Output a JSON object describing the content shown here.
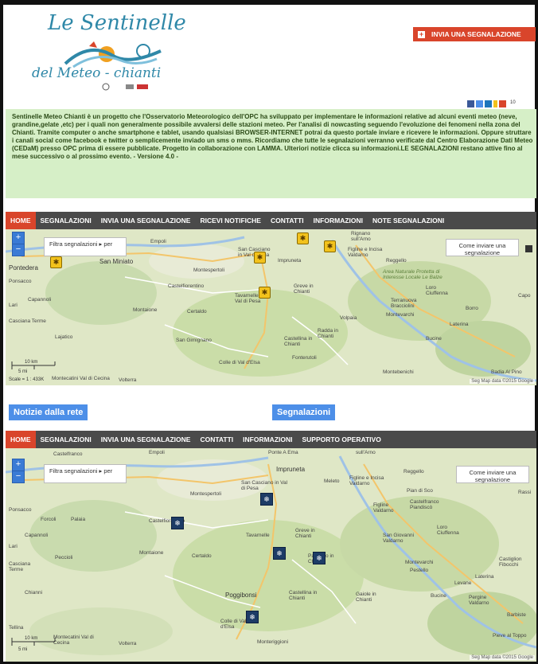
{
  "logo": {
    "line1": "Le Sentinelle",
    "line2": "del Meteo - chianti"
  },
  "report_button": {
    "label": "INVIA UNA SEGNALAZIONE"
  },
  "social": {
    "count": "10"
  },
  "intro_text": "Sentinelle Meteo Chianti è un progetto che l'Osservatorio Meteorologico dell'OPC ha sviluppato per implementare le informazioni relative ad alcuni eventi meteo (neve, grandine,gelate ,etc) per i quali non generalmente possibile avvalersi delle stazioni meteo. Per l'analisi di nowcasting seguendo l'evoluzione dei fenomeni nella zona del Chianti. Tramite computer o anche smartphone e tablet, usando qualsiasi BROWSER-INTERNET potrai da questo portale inviare e ricevere le informazioni. Oppure struttare i canali social come facebook e twitter o semplicemente inviado un sms o mms. Ricordiamo che tutte le segnalazioni verranno verificate dal Centro Elaborazione Dati Meteo (CEDaM) presso OPC prima di essere pubblicate. Progetto in collaborazione con LAMMA. Ulteriori notizie clicca su informazioni.LE SEGNALAZIONI restano attive fino al mese successivo o al prossimo evento. - Versione 4.0 -",
  "nav1": [
    "HOME",
    "SEGNALAZIONI",
    "INVIA UNA SEGNALAZIONE",
    "RICEVI NOTIFICHE",
    "CONTATTI",
    "INFORMAZIONI",
    "NOTE SEGNALAZIONI"
  ],
  "nav2": [
    "HOME",
    "SEGNALAZIONI",
    "INVIA UNA SEGNALAZIONE",
    "CONTATTI",
    "INFORMAZIONI",
    "SUPPORTO OPERATIVO"
  ],
  "map1": {
    "filter": "Filtra segnalazioni ▸ per",
    "help": "Come inviare una segnalazione",
    "scale_text": "Scale = 1 : 433K",
    "scale_km": "10 km",
    "scale_mi": "5 mi",
    "copyright": "Seg   Map data ©2015 Google",
    "places": [
      "Empoli",
      "San Miniato",
      "Pontedera",
      "Ponsacco",
      "Capannoli",
      "Montespertoli",
      "Castelfiorentino",
      "Montaione",
      "Certaldo",
      "Lari",
      "Casciana Terme",
      "Lajatico",
      "Montecatini Val di Cecina",
      "Volterra",
      "San Gimignano",
      "Colle di Val d'Elsa",
      "Impruneta",
      "San Casciano in Val di Pesa",
      "Tavarnelle Val di Pesa",
      "Greve in Chianti",
      "Castellina in Chianti",
      "Radda in Chianti",
      "Fonterutoli",
      "Volpaia",
      "Figline e Incisa Valdarno",
      "Reggello",
      "Rignano sull'Arno",
      "Area Naturale Protetta di Interesse Locale Le Balze",
      "Loro Ciuffenna",
      "Terranuova Bracciolini",
      "Montevarchi",
      "Bucine",
      "Laterina",
      "Borro",
      "Montebenichi",
      "Badia Al Pino",
      "Capo"
    ]
  },
  "map2": {
    "filter": "Filtra segnalazioni ▸ per",
    "help": "Come inviare una segnalazione",
    "scale_km": "10 km",
    "scale_mi": "5 mi",
    "copyright": "Seg   Map data ©2015 Google",
    "places": [
      "Castelfranco",
      "Empoli",
      "Ponte A Ema",
      "sull'Arno",
      "Impruneta",
      "Reggello",
      "Meleto",
      "Figline e Incisa Valdarno",
      "Pian di Sco",
      "Castelfranco Piandiscò",
      "Figline Valdarno",
      "Montespertoli",
      "San Casciano in Val di Pesa",
      "Ponsacco",
      "Forcoli",
      "Palaia",
      "Castelfiorentino",
      "Capannoli",
      "Loro Ciuffenna",
      "Lari",
      "Peccioli",
      "Montaione",
      "Certaldo",
      "Tavarnelle",
      "Greve in Chianti",
      "Panzano in Chianti",
      "San Giovanni Valdarno",
      "Montevarchi",
      "Pestello",
      "Castiglion Fibocchi",
      "Casciana Terme",
      "Chianni",
      "Poggibonsi",
      "Castellina in Chianti",
      "Gaiole in Chianti",
      "Laterina",
      "Levane",
      "Bucine",
      "Pergine Valdarno",
      "Barbiste",
      "Colle di Val d'Elsa",
      "Monteriggioni",
      "Montecatini Val di Cecina",
      "Volterra",
      "Pieve al Toppo",
      "Rassi",
      "Tellina"
    ]
  },
  "section_notizie": "Notizie dalla rete",
  "section_segnalazioni": "Segnalazioni"
}
